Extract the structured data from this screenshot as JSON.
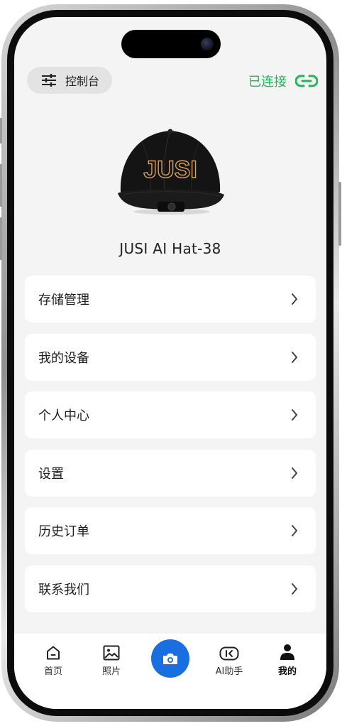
{
  "header": {
    "console_label": "控制台",
    "status_label": "已连接"
  },
  "device": {
    "name": "JUSI AI Hat-38",
    "hat_logo": "JUSI"
  },
  "menu": {
    "items": [
      {
        "label": "存储管理"
      },
      {
        "label": "我的设备"
      },
      {
        "label": "个人中心"
      },
      {
        "label": "设置"
      },
      {
        "label": "历史订单"
      },
      {
        "label": "联系我们"
      }
    ]
  },
  "tabbar": {
    "tabs": [
      {
        "label": "首页",
        "icon": "home-icon"
      },
      {
        "label": "照片",
        "icon": "image-icon"
      },
      {
        "label": "",
        "icon": "camera-icon"
      },
      {
        "label": "AI助手",
        "icon": "ai-assistant-icon"
      },
      {
        "label": "我的",
        "icon": "person-icon",
        "active": true
      }
    ]
  },
  "colors": {
    "connected_green": "#20b559",
    "camera_blue": "#1a6fe0",
    "background": "#f4f4f4"
  }
}
